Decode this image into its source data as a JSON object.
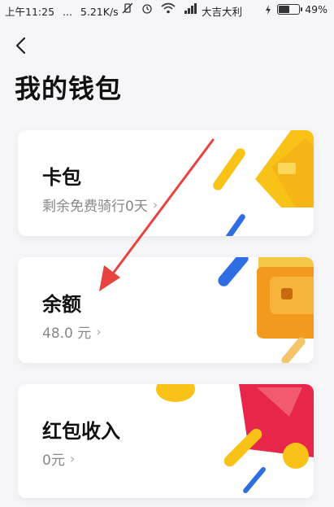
{
  "status_bar": {
    "time": "上午11:25",
    "dots": "...",
    "speed": "5.21K/s",
    "carrier": "大吉大利",
    "battery": "49%"
  },
  "page": {
    "title": "我的钱包"
  },
  "cards": {
    "card_pack": {
      "name": "卡包",
      "sub": "剩余免费骑行0天"
    },
    "balance": {
      "name": "余额",
      "sub": "48.0 元"
    },
    "red_packet": {
      "name": "红包收入",
      "sub": "0元"
    }
  },
  "colors": {
    "yellow": "#f9c216",
    "orange": "#f29a1d",
    "blue": "#2f6de3",
    "red": "#e8264b",
    "arrow": "#e8433f"
  },
  "icons": {
    "back": "chevron-left-icon",
    "chevron": "chevron-right-icon",
    "wifi": "wifi-icon",
    "signal": "signal-icon",
    "alarm": "alarm-icon",
    "battery": "battery-icon",
    "charging": "charging-icon"
  }
}
